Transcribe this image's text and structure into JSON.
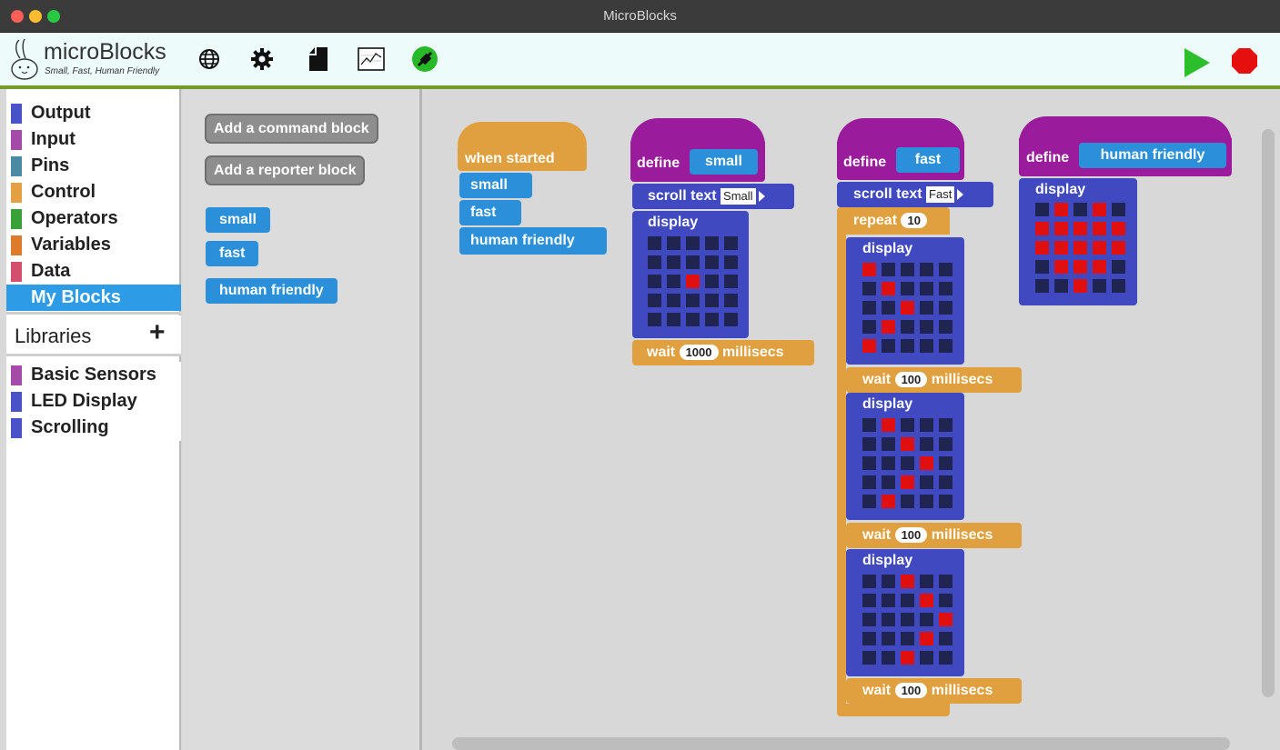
{
  "window": {
    "title": "MicroBlocks"
  },
  "toolbar": {
    "logo_title": "microBlocks",
    "logo_tagline": "Small, Fast, Human Friendly",
    "icons": [
      "globe-icon",
      "gear-icon",
      "file-icon",
      "graph-icon",
      "usb-connected-icon"
    ],
    "go_label": "go",
    "stop_label": "stop"
  },
  "categories": [
    {
      "label": "Output",
      "color": "#4a52c7"
    },
    {
      "label": "Input",
      "color": "#a44aa8"
    },
    {
      "label": "Pins",
      "color": "#4a8aa3"
    },
    {
      "label": "Control",
      "color": "#e3a042"
    },
    {
      "label": "Operators",
      "color": "#3aa13a"
    },
    {
      "label": "Variables",
      "color": "#dd7a2c"
    },
    {
      "label": "Data",
      "color": "#d34f6d"
    },
    {
      "label": "My Blocks",
      "color": "#2e9be6"
    }
  ],
  "libraries": {
    "header": "Libraries",
    "add": "+",
    "items": [
      {
        "label": "Basic Sensors",
        "color": "#a44aa8"
      },
      {
        "label": "LED Display",
        "color": "#4a52c7"
      },
      {
        "label": "Scrolling",
        "color": "#4a52c7"
      }
    ]
  },
  "palette": {
    "add_command": "Add a command block",
    "add_reporter": "Add a reporter block",
    "blocks": [
      "small",
      "fast",
      "human friendly"
    ]
  },
  "scripts": {
    "main": {
      "hat": "when started",
      "calls": [
        "small",
        "fast",
        "human friendly"
      ]
    },
    "small": {
      "define": "define",
      "name": "small",
      "scroll": "scroll text",
      "scroll_value": "Small",
      "display": "display",
      "grid": [
        [
          0,
          0,
          0,
          0,
          0
        ],
        [
          0,
          0,
          0,
          0,
          0
        ],
        [
          0,
          0,
          1,
          0,
          0
        ],
        [
          0,
          0,
          0,
          0,
          0
        ],
        [
          0,
          0,
          0,
          0,
          0
        ]
      ],
      "wait": "wait",
      "wait_value": "1000",
      "wait_unit": "millisecs"
    },
    "fast": {
      "define": "define",
      "name": "fast",
      "scroll": "scroll text",
      "scroll_value": "Fast",
      "repeat": "repeat",
      "repeat_value": "10",
      "displays": [
        {
          "label": "display",
          "grid": [
            [
              1,
              0,
              0,
              0,
              0
            ],
            [
              0,
              1,
              0,
              0,
              0
            ],
            [
              0,
              0,
              1,
              0,
              0
            ],
            [
              0,
              1,
              0,
              0,
              0
            ],
            [
              1,
              0,
              0,
              0,
              0
            ]
          ],
          "wait": "wait",
          "wait_value": "100",
          "wait_unit": "millisecs"
        },
        {
          "label": "display",
          "grid": [
            [
              0,
              1,
              0,
              0,
              0
            ],
            [
              0,
              0,
              1,
              0,
              0
            ],
            [
              0,
              0,
              0,
              1,
              0
            ],
            [
              0,
              0,
              1,
              0,
              0
            ],
            [
              0,
              1,
              0,
              0,
              0
            ]
          ],
          "wait": "wait",
          "wait_value": "100",
          "wait_unit": "millisecs"
        },
        {
          "label": "display",
          "grid": [
            [
              0,
              0,
              1,
              0,
              0
            ],
            [
              0,
              0,
              0,
              1,
              0
            ],
            [
              0,
              0,
              0,
              0,
              1
            ],
            [
              0,
              0,
              0,
              1,
              0
            ],
            [
              0,
              0,
              1,
              0,
              0
            ]
          ],
          "wait": "wait",
          "wait_value": "100",
          "wait_unit": "millisecs"
        }
      ]
    },
    "human_friendly": {
      "define": "define",
      "name": "human friendly",
      "display": "display",
      "grid": [
        [
          0,
          1,
          0,
          1,
          0
        ],
        [
          1,
          1,
          1,
          1,
          1
        ],
        [
          1,
          1,
          1,
          1,
          1
        ],
        [
          0,
          1,
          1,
          1,
          0
        ],
        [
          0,
          0,
          1,
          0,
          0
        ]
      ]
    }
  }
}
